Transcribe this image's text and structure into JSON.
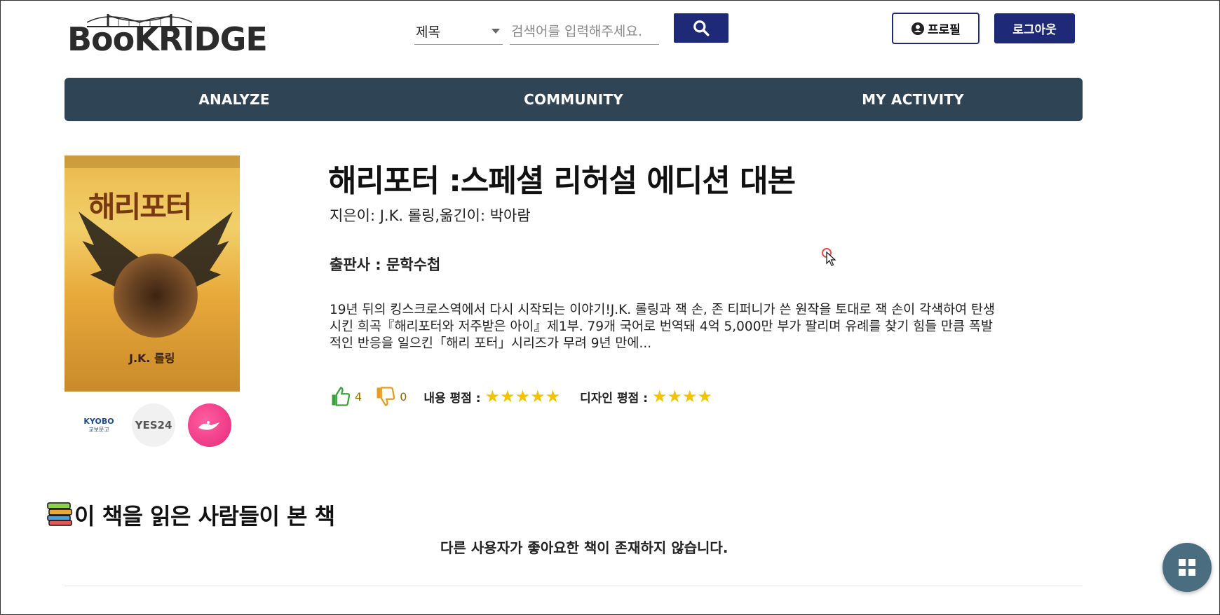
{
  "header": {
    "logo_text": "BooKRIDGE",
    "search": {
      "type_selected": "제목",
      "placeholder": "검색어를 입력해주세요."
    },
    "profile_label": "프로필",
    "logout_label": "로그아웃"
  },
  "nav": [
    {
      "label": "ANALYZE"
    },
    {
      "label": "COMMUNITY"
    },
    {
      "label": "MY ACTIVITY"
    }
  ],
  "book": {
    "cover": {
      "title": "해리포터",
      "author": "J.K. 롤링"
    },
    "title": "해리포터 :스페셜 리허설 에디션 대본",
    "author_line": "지은이: J.K. 롤링,옮긴이: 박아람",
    "publisher_line": "출판사 : 문학수첩",
    "description": "19년 뒤의 킹스크로스역에서 다시 시작되는 이야기!J.K. 롤링과 잭 손, 존 티퍼니가 쓴 원작을 토대로 잭 손이 각색하여 탄생시킨 희곡『해리포터와 저주받은 아이』제1부. 79개 국어로 번역돼 4억 5,000만 부가 팔리며 유례를 찾기 힘들 만큼 폭발적인 반응을 일으킨「해리 포터」시리즈가 무려 9년 만에...",
    "likes": "4",
    "dislikes": "0",
    "content_rating_label": "내용 평점 :",
    "content_rating": 5,
    "design_rating_label": "디자인 평점 :",
    "design_rating": 4
  },
  "stores": [
    {
      "name": "KYOBO",
      "sub": "교보문고",
      "icon": "kyobo-logo"
    },
    {
      "name": "YES24",
      "icon": "yes24-logo"
    },
    {
      "name": "aladin",
      "icon": "aladin-genie-lamp-logo"
    }
  ],
  "related": {
    "title": "이 책을 읽은 사람들이 본 책",
    "empty_message": "다른 사용자가 좋아요한 책이 존재하지 않습니다."
  },
  "colors": {
    "navy": "#1e2a78",
    "navbar": "#2f4555",
    "star": "#f2c300",
    "fab": "#4b6d80"
  }
}
